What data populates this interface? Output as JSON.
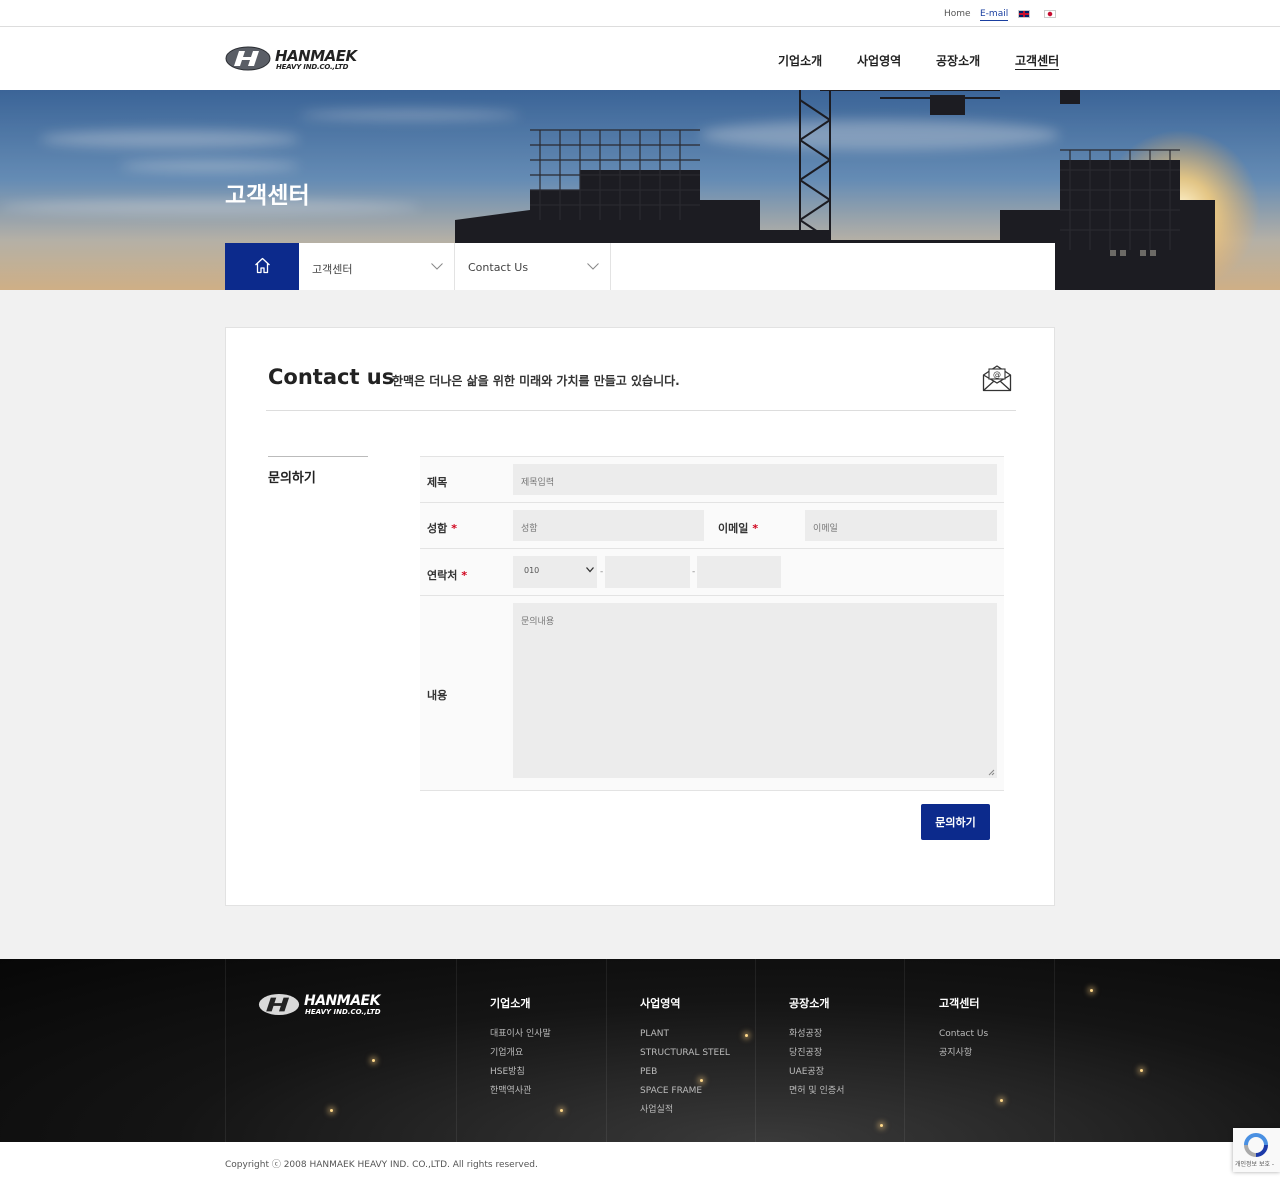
{
  "topbar": {
    "home": "Home",
    "email": "E-mail"
  },
  "brand": {
    "name": "HANMAEK",
    "sub": "HEAVY IND.CO.,LTD"
  },
  "nav": [
    "기업소개",
    "사업영역",
    "공장소개",
    "고객센터"
  ],
  "hero": {
    "title": "고객센터"
  },
  "breadcrumb": {
    "level1": "고객센터",
    "level2": "Contact Us"
  },
  "contact": {
    "title": "Contact us",
    "subtitle": "한맥은 더나은 삶을 위한 미래와 가치를 만들고 있습니다.",
    "side_label": "문의하기",
    "form": {
      "subject_label": "제목",
      "subject_placeholder": "제목입력",
      "name_label": "성함",
      "name_placeholder": "성함",
      "email_label": "이메일",
      "email_placeholder": "이메일",
      "phone_label": "연락처",
      "phone_prefix": "010",
      "phone_sep": "-",
      "message_label": "내용",
      "message_placeholder": "문의내용",
      "required_mark": "*",
      "submit": "문의하기"
    }
  },
  "footer": {
    "columns": [
      {
        "title": "기업소개",
        "items": [
          "대표이사 인사말",
          "기업개요",
          "HSE방침",
          "한맥역사관"
        ]
      },
      {
        "title": "사업영역",
        "items": [
          "PLANT",
          "STRUCTURAL STEEL",
          "PEB",
          "SPACE FRAME",
          "사업실적"
        ]
      },
      {
        "title": "공장소개",
        "items": [
          "화성공장",
          "당진공장",
          "UAE공장",
          "면허 및 인증서"
        ]
      },
      {
        "title": "고객센터",
        "items": [
          "Contact Us",
          "공지사항"
        ]
      }
    ],
    "copyright": "Copyright ⓒ 2008 HANMAEK HEAVY IND. CO.,LTD. All rights reserved."
  },
  "recaptcha": {
    "label": "개인정보 보호 -"
  },
  "colors": {
    "primary": "#0c2a8c",
    "required": "#d0021b"
  }
}
